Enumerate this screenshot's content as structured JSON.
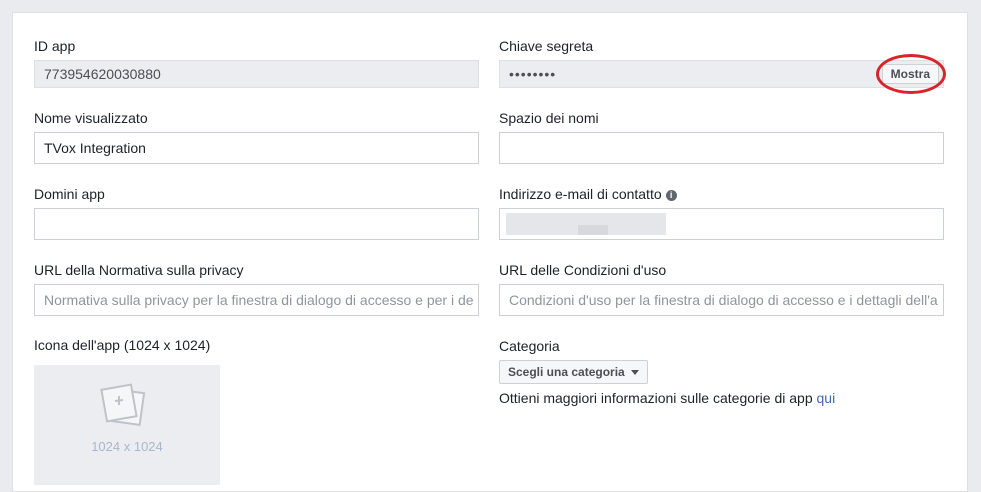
{
  "app_id": {
    "label": "ID app",
    "value": "773954620030880"
  },
  "secret_key": {
    "label": "Chiave segreta",
    "value": "••••••••",
    "show_button": "Mostra"
  },
  "display_name": {
    "label": "Nome visualizzato",
    "value": "TVox Integration"
  },
  "namespace": {
    "label": "Spazio dei nomi",
    "value": ""
  },
  "app_domains": {
    "label": "Domini app",
    "value": ""
  },
  "contact_email": {
    "label": "Indirizzo e-mail di contatto",
    "value": ""
  },
  "privacy_url": {
    "label": "URL della Normativa sulla privacy",
    "placeholder": "Normativa sulla privacy per la finestra di dialogo di accesso e per i de"
  },
  "terms_url": {
    "label": "URL delle Condizioni d'uso",
    "placeholder": "Condizioni d'uso per la finestra di dialogo di accesso e i dettagli dell'a"
  },
  "app_icon": {
    "label": "Icona dell'app (1024 x 1024)",
    "size_text": "1024 x 1024"
  },
  "category": {
    "label": "Categoria",
    "button": "Scegli una categoria",
    "info_text": "Ottieni maggiori informazioni sulle categorie di app ",
    "info_link": "qui"
  },
  "colors": {
    "highlight": "#d9242b",
    "link": "#4267b2"
  }
}
